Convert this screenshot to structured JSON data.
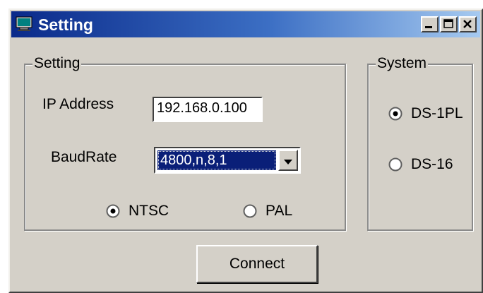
{
  "window": {
    "title": "Setting",
    "icon": "monitor-icon",
    "controls": [
      "minimize-icon",
      "maximize-icon",
      "close-icon"
    ]
  },
  "setting_group": {
    "legend": "Setting",
    "ip_label": "IP Address",
    "ip_value": "192.168.0.100",
    "baud_label": "BaudRate",
    "baud_value": "4800,n,8,1",
    "video_options": [
      {
        "label": "NTSC",
        "selected": true
      },
      {
        "label": "PAL",
        "selected": false
      }
    ]
  },
  "system_group": {
    "legend": "System",
    "options": [
      {
        "label": "DS-1PL",
        "selected": true
      },
      {
        "label": "DS-16",
        "selected": false
      }
    ]
  },
  "connect_button": {
    "label": "Connect"
  },
  "colors": {
    "title_start": "#0a2a8a",
    "title_end": "#a6caf0",
    "face": "#d4d0c8",
    "selection": "#0a1f78"
  }
}
